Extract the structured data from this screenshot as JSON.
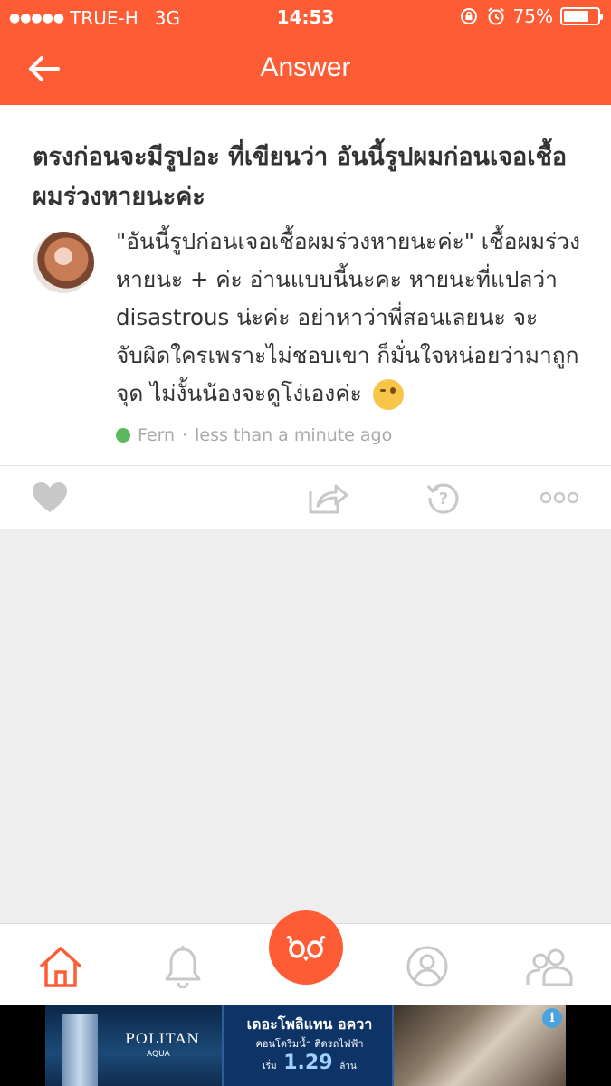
{
  "status_bar": {
    "signal_dots": "●●●●●",
    "carrier": "TRUE-H",
    "network": "3G",
    "time": "14:53",
    "battery_text": "75%",
    "battery_level": 0.75
  },
  "nav": {
    "title": "Answer",
    "back_icon": "arrow-left-icon"
  },
  "post": {
    "question": "ตรงก่อนจะมีรูปอะ ที่เขียนว่า อันนี้รูปผมก่อนเจอเชื้อผมร่วงหายนะค่ะ",
    "answer": "\"อันนี้รูปก่อนเจอเชื้อผมร่วงหายนะค่ะ\" เชื้อผมร่วงหายนะ + ค่ะ อ่านแบบนี้นะคะ หายนะที่แปลว่า disastrous น่ะค่ะ อย่าหาว่าพี่สอนเลยนะ จะจับผิดใครเพราะไม่ชอบเขา ก็มั่นใจหน่อยว่ามาถูกจุด ไม่งั้นน้องจะดูโง่เองค่ะ",
    "emoji": "winking-face",
    "author": "Fern",
    "time_ago": "less than a minute ago",
    "separator": "·"
  },
  "actions": [
    "heart-icon",
    "share-icon",
    "history-icon",
    "more-icon"
  ],
  "tabs": [
    "home-icon",
    "bell-icon",
    "mascot-icon",
    "profile-icon",
    "friends-icon"
  ],
  "ad": {
    "brand": "POLITAN",
    "brand_sub": "AQUA",
    "line1": "เดอะโพลิแทน อควา",
    "line2": "คอนโดริมน้ำ ติดรถไฟฟ้า",
    "price": "1.29",
    "price_prefix": "เริ่ม",
    "price_suffix": "ล้าน",
    "info": "i"
  },
  "colors": {
    "accent": "#fe5c35",
    "online": "#5cb85c",
    "icon_grey": "#c8c8c8"
  }
}
